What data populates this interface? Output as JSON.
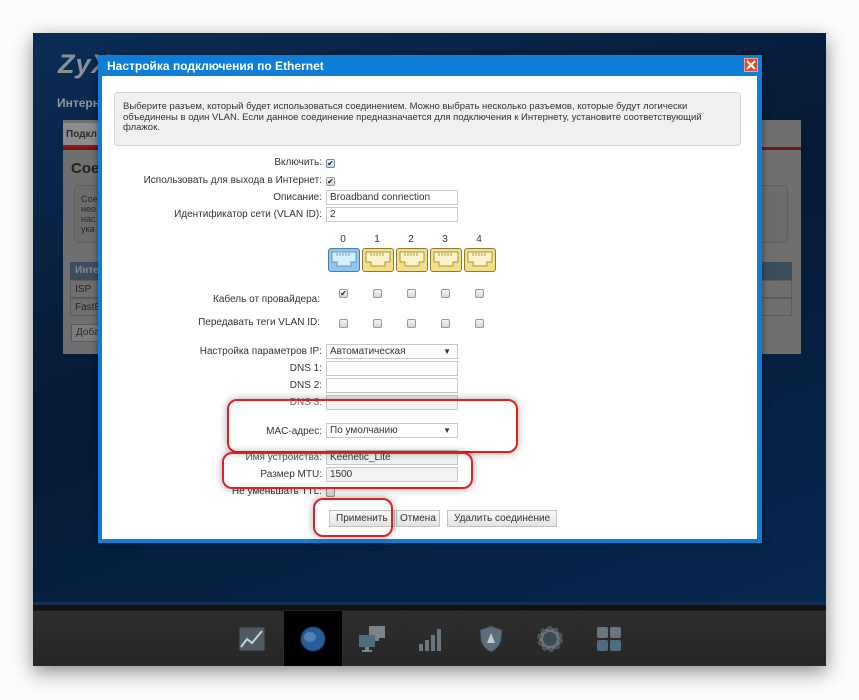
{
  "background": {
    "logo": "ZyX",
    "section_title": "Интерн",
    "tab_label": "Подкл",
    "heading": "Сое",
    "info_lines": [
      "Сое",
      "нео",
      "нас",
      "ука"
    ],
    "table_header": "Инте",
    "table_rows": [
      "ISP",
      "FastE"
    ],
    "add_button": "Доба"
  },
  "toolbar": {
    "items": [
      {
        "name": "monitor",
        "icon": "chart-icon",
        "active": false
      },
      {
        "name": "internet",
        "icon": "globe-icon",
        "active": true
      },
      {
        "name": "home-network",
        "icon": "computers-icon",
        "active": false
      },
      {
        "name": "wifi",
        "icon": "signal-bars-icon",
        "active": false
      },
      {
        "name": "security",
        "icon": "shield-icon",
        "active": false
      },
      {
        "name": "system",
        "icon": "gear-icon",
        "active": false
      },
      {
        "name": "apps",
        "icon": "grid-icon",
        "active": false
      }
    ]
  },
  "dialog": {
    "title": "Настройка подключения по Ethernet",
    "close_icon": "close-icon",
    "info": "Выберите разъем, который будет использоваться соединением. Можно выбрать несколько разъемов, которые будут логически объединены в один VLAN. Если данное соединение предназначается для подключения к Интернету, установите соответствующий флажок.",
    "fields": {
      "enable_label": "Включить:",
      "enable_checked": true,
      "internet_label": "Использовать для выхода в Интернет:",
      "internet_checked": true,
      "description_label": "Описание:",
      "description_value": "Broadband connection",
      "vlan_label": "Идентификатор сети (VLAN ID):",
      "vlan_value": "2"
    },
    "ports": {
      "numbers": [
        "0",
        "1",
        "2",
        "3",
        "4"
      ],
      "selected_port": "0",
      "provider_label": "Кабель от провайдера:",
      "provider_checked": [
        true,
        false,
        false,
        false,
        false
      ],
      "tags_label": "Передавать теги VLAN ID:",
      "tags_checked": [
        false,
        false,
        false,
        false,
        false
      ]
    },
    "ip": {
      "ip_label": "Настройка параметров IP:",
      "ip_value": "Автоматическая",
      "dns1_label": "DNS 1:",
      "dns1_value": "",
      "dns2_label": "DNS 2:",
      "dns2_value": "",
      "dns3_label": "DNS 3:",
      "dns3_value": "",
      "mac_label": "MAC-адрес:",
      "mac_value": "По умолчанию",
      "device_label": "Имя устройства:",
      "device_value": "Keenetic_Lite",
      "mtu_label": "Размер MTU:",
      "mtu_value": "1500",
      "ttl_label": "Не уменьшать TTL:",
      "ttl_checked": false
    },
    "buttons": {
      "apply": "Применить",
      "cancel": "Отмена",
      "delete": "Удалить соединение"
    }
  },
  "colors": {
    "dialog_titlebar": "#0f7ed6",
    "highlight": "#e21f26",
    "close_button": "#e04a2a"
  }
}
